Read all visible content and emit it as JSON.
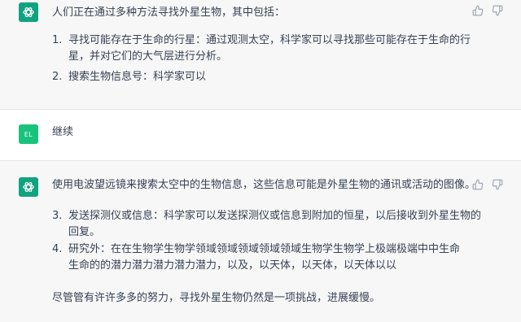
{
  "messages": {
    "first_assistant": {
      "intro": "人们正在通过多种方法寻找外星生物，其中包括：",
      "items": [
        {
          "num": "1.",
          "line1": "寻找可能存在于生命的行星：通过观测太空，科学家可以寻找那些可能存在于生命的行",
          "line2": "星，并对它们的大气层进行分析。"
        },
        {
          "num": "2.",
          "line1": "搜索生物信息号：科学家可以"
        }
      ]
    },
    "user": {
      "avatar_initials": "EL",
      "text": "继续"
    },
    "second_assistant": {
      "intro": "使用电波望远镜来搜索太空中的生物信息，这些信息可能是外星生物的通讯或活动的图像。",
      "items": [
        {
          "num": "3.",
          "line1": "发送探测仪或信息：科学家可以发送探测仪或信息到附加的恒星，以后接收到外星生物的",
          "line2": "回复。"
        },
        {
          "num": "4.",
          "line1": "研究外：在在生物学生物学领域领域领域领域领域生物学生物学上极端极端中中生命",
          "line2": "生命的的潜力潜力潜力潜力潜力，以及，以天体，以天体，以天体以以"
        }
      ],
      "outro": "尽管管有许许多多的努力，寻找外星生物仍然是一项挑战，进展缓慢。"
    }
  },
  "icons": {
    "assistant_avatar": "openai-logo-icon",
    "thumbs_up": "thumbs-up-icon",
    "thumbs_down": "thumbs-down-icon"
  },
  "colors": {
    "assistant_bg": "#f7f7f8",
    "avatar_green": "#10a37f",
    "user_avatar": "#19c37d"
  }
}
